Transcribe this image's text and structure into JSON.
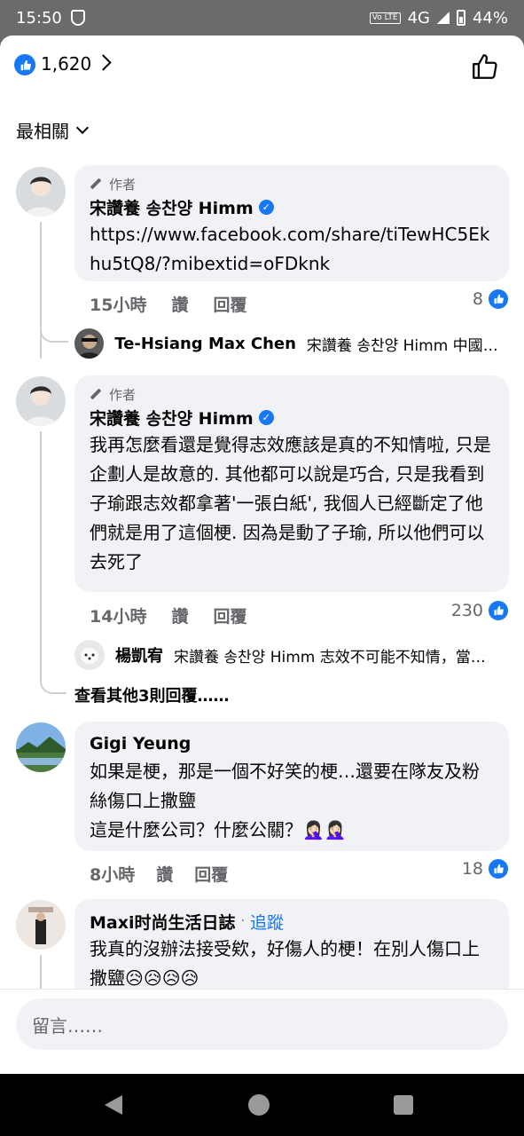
{
  "status": {
    "time": "15:50",
    "network": "4G",
    "battery": "44%",
    "volte": "Vo LTE"
  },
  "header": {
    "like_count": "1,620"
  },
  "sort": {
    "label": "最相關"
  },
  "comments": [
    {
      "author_tag": "作者",
      "name": "宋讚養 송찬양 Himm",
      "text": "https://www.facebook.com/share/tiTewHC5Ekhu5tQ8/?mibextid=oFDknk",
      "time": "15小時",
      "like": "讚",
      "reply": "回覆",
      "reactions": "8"
    },
    {
      "author_tag": "作者",
      "name": "宋讚養 송찬양 Himm",
      "text": "我再怎麼看還是覺得志效應該是真的不知情啦, 只是企劃人是故意的. 其他都可以說是巧合, 只是我看到子瑜跟志效都拿著'一張白紙', 我個人已經斷定了他們就是用了這個梗. 因為是動了子瑜, 所以他們可以去死了",
      "time": "14小時",
      "like": "讚",
      "reply": "回覆",
      "reactions": "230"
    },
    {
      "name": "Gigi Yeung",
      "text_lines": [
        "如果是梗，那是一個不好笑的梗…還要在隊友及粉絲傷口上撒鹽",
        "這是什麼公司？什麼公關？🤦🏻‍♀️🤦🏻‍♀️"
      ],
      "time": "8小時",
      "like": "讚",
      "reply": "回覆",
      "reactions": "18"
    },
    {
      "name": "Maxi时尚生活日誌",
      "follow": "追蹤",
      "text": "我真的沒辦法接受欸，好傷人的梗！在別人傷口上撒鹽😥😥😥😥"
    }
  ],
  "replies": [
    {
      "name": "Te-Hsiang Max Chen",
      "text": "宋讚養 송찬양 Himm 中國只…"
    },
    {
      "name": "楊凱宥",
      "text": "宋讚養 송찬양 Himm 志效不可能不知情，當…"
    }
  ],
  "more_replies": "查看其他3則回覆……",
  "composer": {
    "placeholder": "留言……"
  },
  "icons": {
    "like": "thumbs-up-icon",
    "verified": "verified-badge-icon",
    "pen": "pen-icon"
  },
  "colors": {
    "accent": "#1877f2",
    "bubble": "#f0f2f5",
    "muted": "#65676b"
  }
}
